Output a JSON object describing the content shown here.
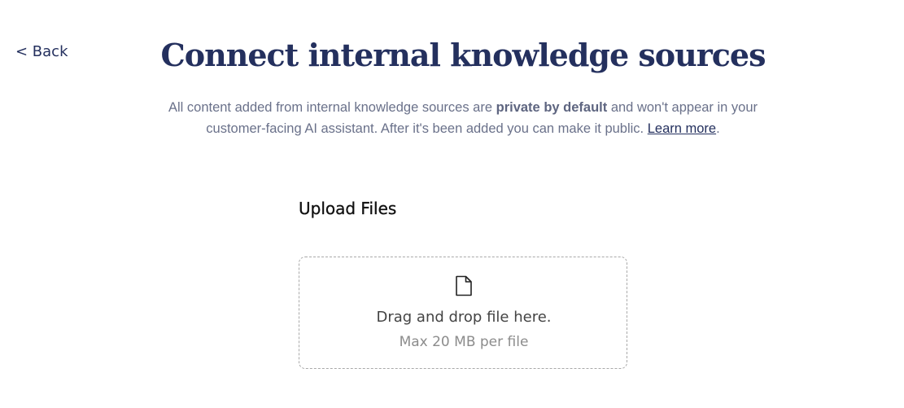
{
  "nav": {
    "back_label": "< Back"
  },
  "header": {
    "title": "Connect internal knowledge sources",
    "subtitle_part1": "All content added from internal knowledge sources are ",
    "subtitle_bold": "private by default",
    "subtitle_part2": " and won't appear in your customer-facing AI assistant. After it's been added you can make it public. ",
    "learn_more_label": "Learn more",
    "subtitle_end": "."
  },
  "upload": {
    "heading": "Upload Files",
    "icon": "file-icon",
    "drop_text": "Drag and drop file here.",
    "limit_text": "Max 20 MB per file"
  },
  "colors": {
    "primary": "#24305e",
    "muted_text": "#6a718a",
    "dropzone_border": "#a9a9a9"
  }
}
